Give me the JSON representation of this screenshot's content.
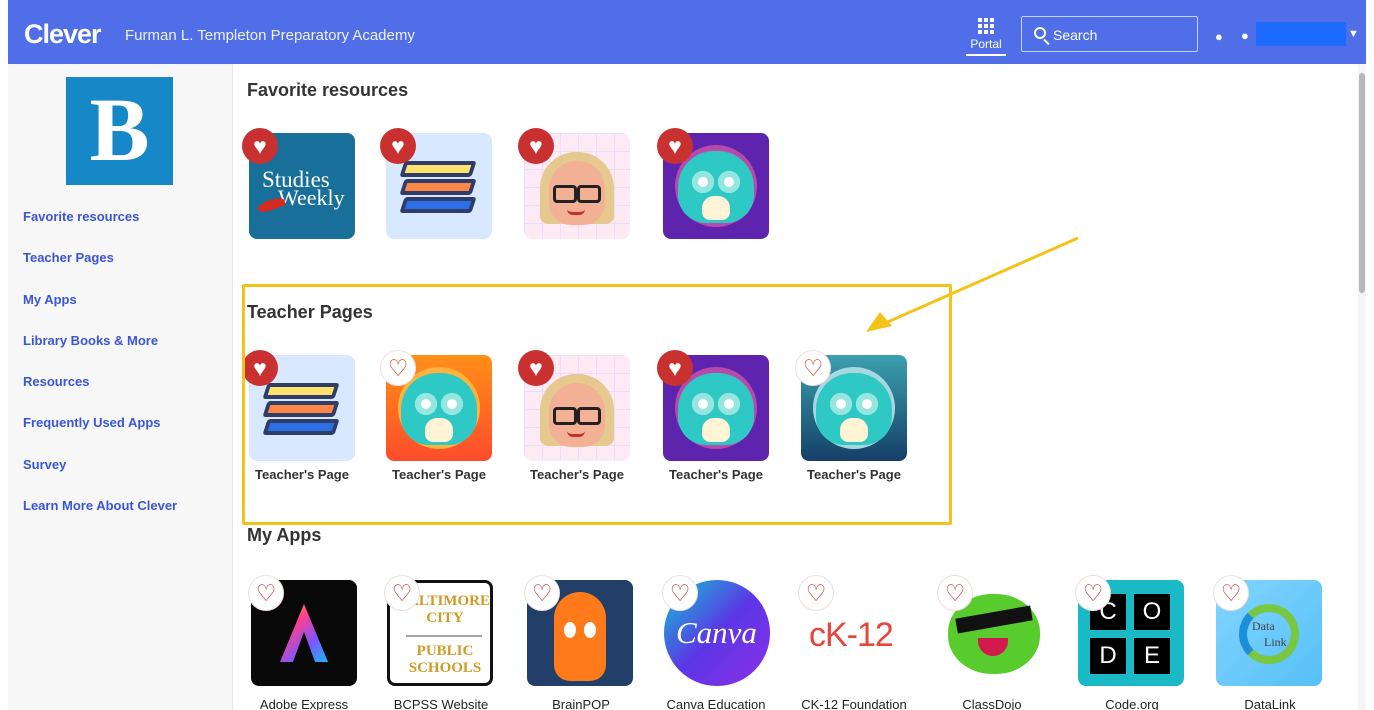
{
  "header": {
    "logo": "Clever",
    "school": "Furman L. Templeton Preparatory Academy",
    "portal_label": "Portal",
    "search_placeholder": "Search"
  },
  "brand": {
    "letter": "B"
  },
  "sidebar": {
    "items": [
      "Favorite resources",
      "Teacher Pages",
      "My Apps",
      "Library Books & More",
      "Resources",
      "Frequently Used Apps",
      "Survey",
      "Learn More About Clever"
    ]
  },
  "sections": {
    "favorites": "Favorite resources",
    "teacher_pages": "Teacher Pages",
    "my_apps": "My Apps"
  },
  "teacher_page_labels": [
    "Teacher's Page",
    "Teacher's Page",
    "Teacher's Page",
    "Teacher's Page",
    "Teacher's Page"
  ],
  "apps": [
    {
      "label": "Adobe Express"
    },
    {
      "label": "BCPSS Website"
    },
    {
      "label": "BrainPOP"
    },
    {
      "label": "Canva Education"
    },
    {
      "label": "CK-12 Foundation"
    },
    {
      "label": "ClassDojo"
    },
    {
      "label": "Code.org"
    },
    {
      "label": "DataLink"
    }
  ],
  "tile_text": {
    "studies_1": "Studies",
    "studies_2": "Weekly",
    "baltimore_1": "ALTIMORE",
    "baltimore_2": "CITY",
    "baltimore_3": "PUBLIC",
    "baltimore_4": "SCHOOLS",
    "canva": "Canva",
    "ck12": "cK-12",
    "code_1": "C",
    "code_2": "O",
    "code_3": "D",
    "code_4": "E",
    "data_1": "Data",
    "data_2": "Link"
  },
  "colors": {
    "header": "#4f6ee8",
    "link": "#3a55d6",
    "favorite_heart": "#c93131",
    "highlight": "#f4c319"
  },
  "icons": {
    "heart_filled": "♥",
    "heart_empty": "♡",
    "bell": "🔔",
    "user": "👤",
    "caret": "▼",
    "help": "?"
  }
}
